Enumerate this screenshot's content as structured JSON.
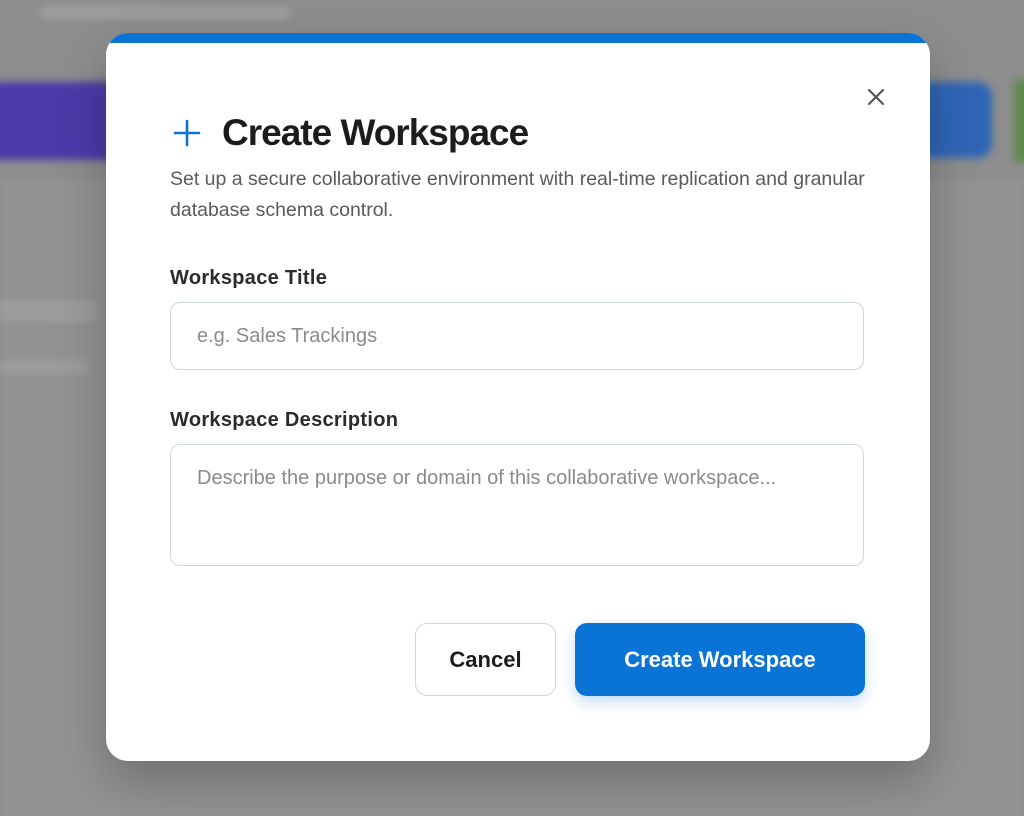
{
  "modal": {
    "title": "Create Workspace",
    "subtitle": "Set up a secure collaborative environment with real-time replication and granular database schema control.",
    "accent_color": "#0a74d6",
    "icons": {
      "title_icon": "plus-icon",
      "close_icon": "close-icon"
    }
  },
  "form": {
    "title_label": "Workspace Title",
    "title_placeholder": "e.g. Sales Trackings",
    "title_value": "",
    "description_label": "Workspace Description",
    "description_placeholder": "Describe the purpose or domain of this collaborative workspace...",
    "description_value": ""
  },
  "actions": {
    "cancel_label": "Cancel",
    "submit_label": "Create Workspace"
  }
}
